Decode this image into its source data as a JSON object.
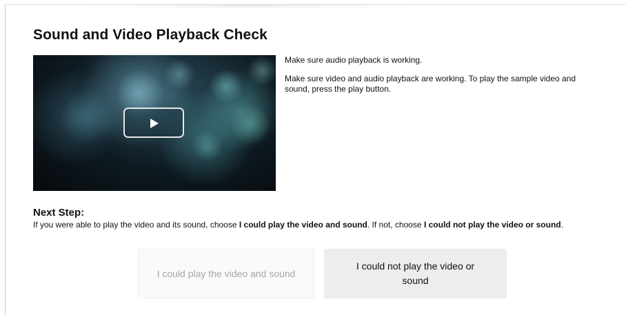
{
  "page": {
    "title": "Sound and Video Playback Check"
  },
  "video": {
    "play_icon": "play-icon"
  },
  "description": {
    "line1": "Make sure audio playback is working.",
    "line2": "Make sure video and audio playback are working. To play the sample video and sound, press the play button."
  },
  "next_step": {
    "heading": "Next Step:",
    "text_part1": "If you were able to play the video and its sound, choose ",
    "bold1": "I could play the video and sound",
    "text_part2": ". If not, choose ",
    "bold2": "I could not play the video or sound",
    "text_part3": "."
  },
  "buttons": {
    "could_play": "I could play the video and sound",
    "could_not_play": "I could not play the video or sound"
  },
  "colors": {
    "disabled_text": "#a5a5a5",
    "secondary_button_bg": "#ededed"
  }
}
